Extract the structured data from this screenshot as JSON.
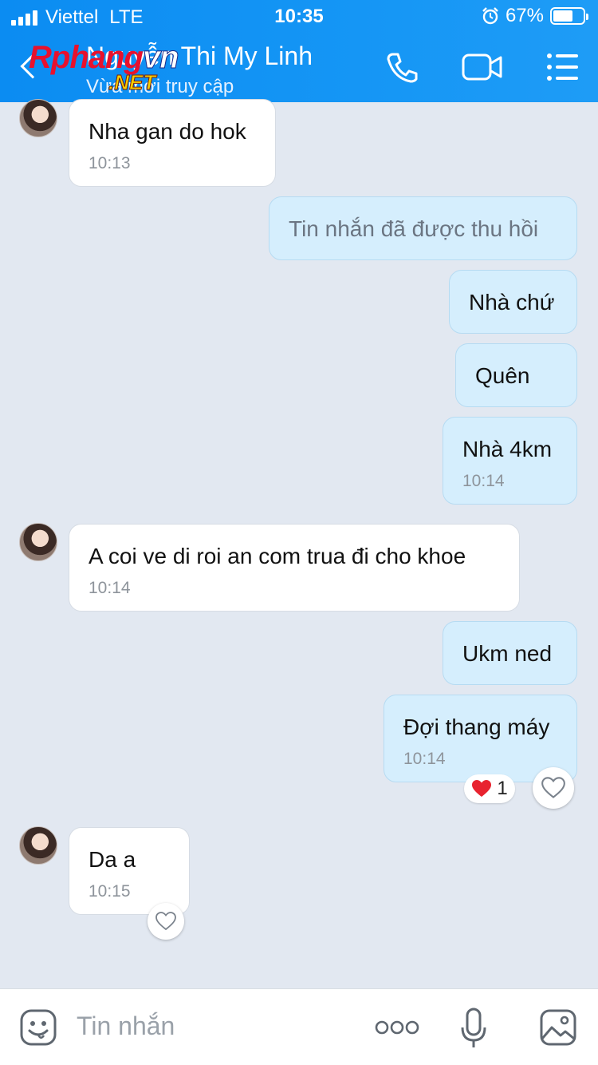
{
  "status_bar": {
    "carrier": "Viettel",
    "network": "LTE",
    "time": "10:35",
    "battery": "67%",
    "battery_level": 0.67
  },
  "header": {
    "name": "Nguyễn Thi My Linh",
    "subtitle": "Vừa mới truy cập",
    "watermark_main": "Rphang",
    "watermark_accent": "vn",
    "watermark_net": ".NET",
    "icons": [
      "back-icon",
      "phone-icon",
      "video-call-icon",
      "menu-icon"
    ]
  },
  "messages": [
    {
      "dir": "in",
      "text": "Nha gan do hok",
      "time": "10:13"
    },
    {
      "dir": "out",
      "text": "Tin nhắn đã được thu hồi",
      "recalled": true
    },
    {
      "dir": "out",
      "text": "Nhà chứ"
    },
    {
      "dir": "out",
      "text": "Quên"
    },
    {
      "dir": "out",
      "text": "Nhà 4km",
      "time": "10:14"
    },
    {
      "dir": "in",
      "text": "A coi ve di roi an com trua đi cho khoe",
      "time": "10:14"
    },
    {
      "dir": "out",
      "text": "Ukm ned"
    },
    {
      "dir": "out",
      "text": "Đợi thang máy",
      "time": "10:14",
      "reaction_count": "1"
    },
    {
      "dir": "in",
      "text": "Da a",
      "time": "10:15"
    }
  ],
  "input": {
    "placeholder": "Tin nhắn",
    "icons": [
      "emoji-icon",
      "more-icon",
      "microphone-icon",
      "image-icon"
    ]
  },
  "colors": {
    "header": "#1596f5",
    "background": "#e2e8f1",
    "outgoing_bubble": "#d5eefd",
    "incoming_bubble": "#ffffff",
    "heart": "#e8232f"
  }
}
